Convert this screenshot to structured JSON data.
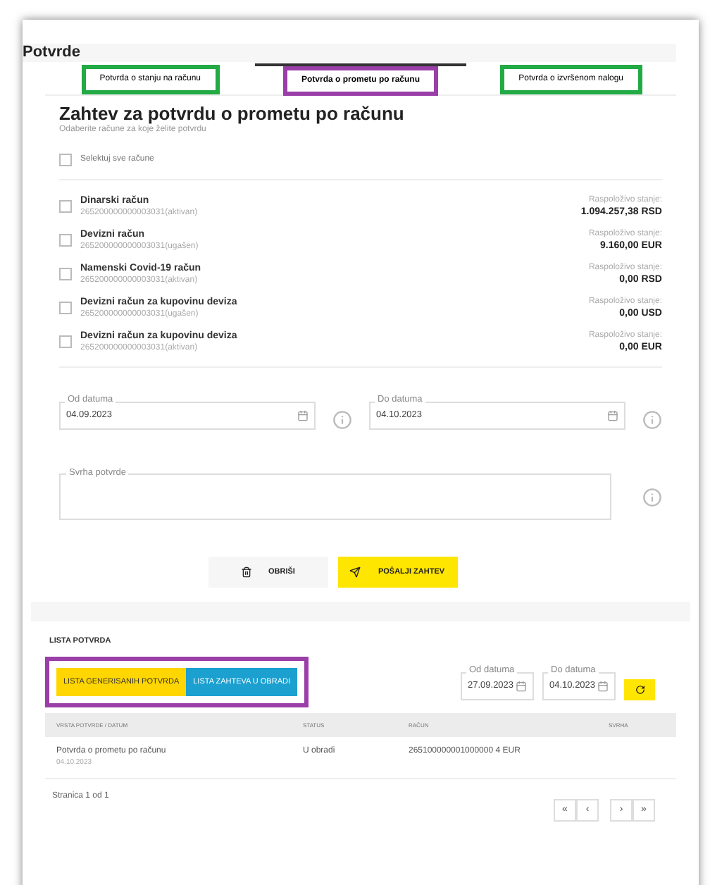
{
  "title": "Potvrde",
  "tabs": [
    {
      "label": "Potvrda o stanju na računu",
      "selected": false,
      "color": "#22aa44"
    },
    {
      "label": "Potvrda o prometu po računu",
      "selected": true,
      "color": "#9b3fa8"
    },
    {
      "label": "Potvrda o izvršenom nalogu",
      "selected": false,
      "color": "#22aa44"
    }
  ],
  "heading": "Zahtev za potvrdu o prometu po računu",
  "subheading": "Odaberite račune za koje želite potvrdu",
  "select_all": {
    "label": "Selektuj sve račune",
    "checked": false
  },
  "accounts": [
    {
      "name": "Dinarski račun",
      "number": "265200000000003031(aktivan)",
      "balance_label": "Raspoloživo stanje:",
      "balance": "1.094.257,38 RSD",
      "checked": false
    },
    {
      "name": "Devizni račun",
      "number": "265200000000003031(ugašen)",
      "balance_label": "Raspoloživo stanje:",
      "balance": "9.160,00 EUR",
      "checked": false
    },
    {
      "name": "Namenski Covid-19 račun",
      "number": "265200000000003031(aktivan)",
      "balance_label": "Raspoloživo stanje:",
      "balance": "0,00 RSD",
      "checked": false
    },
    {
      "name": "Devizni račun za kupovinu deviza",
      "number": "265200000000003031(ugašen)",
      "balance_label": "Raspoloživo stanje:",
      "balance": "0,00 USD",
      "checked": false
    },
    {
      "name": "Devizni račun za kupovinu deviza",
      "number": "265200000000003031(aktivan)",
      "balance_label": "Raspoloživo stanje:",
      "balance": "0,00 EUR",
      "checked": false
    }
  ],
  "date_from": {
    "label": "Od datuma",
    "value": "04.09.2023"
  },
  "date_to": {
    "label": "Do datuma",
    "value": "04.10.2023"
  },
  "purpose": {
    "label": "Svrha potvrde"
  },
  "buttons": [
    {
      "kind": "delete",
      "label": "OBRIŠI"
    },
    {
      "kind": "send",
      "label": "POŠALJI ZAHTEV"
    }
  ],
  "list": {
    "title": "LISTA POTVRDA",
    "toggles": [
      {
        "label": "LISTA GENERISANIH POTVRDA",
        "selected": true
      },
      {
        "label": "LISTA ZAHTEVA U OBRADI",
        "selected": false
      }
    ],
    "toggles_highlighted": true,
    "date_from": {
      "label": "Od datuma",
      "value": "27.09.2023"
    },
    "date_to": {
      "label": "Do datuma",
      "value": "04.10.2023"
    },
    "columns": [
      "VRSTA POTVRDE / DATUM",
      "STATUS",
      "RAČUN",
      "SVRHA"
    ],
    "rows": [
      {
        "type": "Potvrda o prometu po računu",
        "date": "04.10.2023",
        "status": "U obradi",
        "account": "265100000001000000 4 EUR"
      }
    ],
    "pagination": "Stranica 1 od 1",
    "pager": [
      "«",
      "‹",
      "›",
      "»"
    ]
  }
}
